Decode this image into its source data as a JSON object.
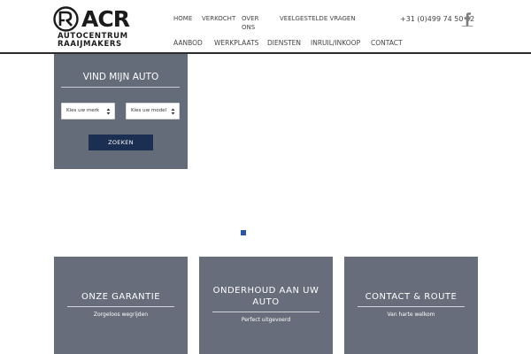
{
  "brand": {
    "name": "ACR",
    "tagline_line1": "AUTOCENTRUM",
    "tagline_line2": "RAAIJMAKERS"
  },
  "top_nav": [
    {
      "label": "HOME"
    },
    {
      "label": "VERKOCHT"
    },
    {
      "label": "OVER ONS"
    },
    {
      "label": "VEELGESTELDE VRAGEN"
    }
  ],
  "contact": {
    "phone": "+31 (0)499 74 50 62",
    "social_icon": "facebook-icon"
  },
  "main_nav": [
    {
      "label": "AANBOD"
    },
    {
      "label": "WERKPLAATS"
    },
    {
      "label": "DIENSTEN"
    },
    {
      "label": "INRUIL/INKOOP"
    },
    {
      "label": "CONTACT"
    }
  ],
  "search": {
    "title": "VIND MIJN AUTO",
    "brand_select": "Kies uw merk",
    "model_select": "Kies uw model",
    "submit_label": "ZOEKEN"
  },
  "cards": [
    {
      "title": "ONZE GARANTIE",
      "subtitle": "Zorgeloos wegrijden"
    },
    {
      "title_line1": "ONDERHOUD AAN UW",
      "title_line2": "AUTO",
      "subtitle": "Perfect uitgevoerd"
    },
    {
      "title": "CONTACT & ROUTE",
      "subtitle": "Van harte welkom"
    }
  ],
  "colors": {
    "panel": "#646b79",
    "button": "#1b2f52",
    "slider_dot": "#2a56a6",
    "header_line": "#2c2c2c"
  }
}
